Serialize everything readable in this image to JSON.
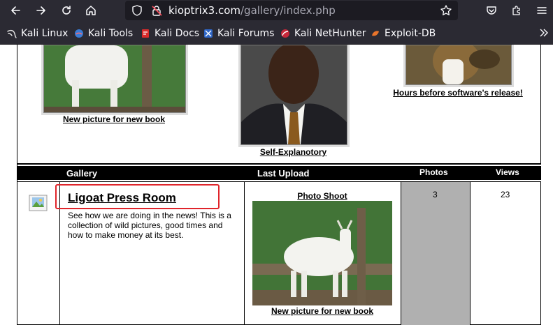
{
  "browser": {
    "url_host": "kioptrix3.com",
    "url_path": "/gallery/index.php",
    "bookmarks": [
      {
        "label": "Kali Linux",
        "icon": "kali-dragon-icon"
      },
      {
        "label": "Kali Tools",
        "icon": "kali-tools-icon"
      },
      {
        "label": "Kali Docs",
        "icon": "kali-docs-icon"
      },
      {
        "label": "Kali Forums",
        "icon": "kali-forums-icon"
      },
      {
        "label": "Kali NetHunter",
        "icon": "nethunter-icon"
      },
      {
        "label": "Exploit-DB",
        "icon": "exploit-db-icon"
      }
    ]
  },
  "featured": [
    {
      "caption": "New picture for new book"
    },
    {
      "caption": "Self-Explanotory"
    },
    {
      "caption": "Hours before software's release!"
    }
  ],
  "table": {
    "headers": {
      "gallery": "Gallery",
      "last_upload": "Last Upload",
      "photos": "Photos",
      "views": "Views"
    },
    "rows": [
      {
        "title": "Ligoat Press Room",
        "description": "See how we are doing in the news! This is a collection of wild pictures, good times and how to make money at its best.",
        "last_upload_title": "Photo Shoot",
        "last_upload_caption": "New picture for new book",
        "photos": "3",
        "views": "23"
      }
    ]
  },
  "colors": {
    "highlight": "#e0252b",
    "chrome": "#2b2a33",
    "photos_cell": "#b0b0b0"
  }
}
